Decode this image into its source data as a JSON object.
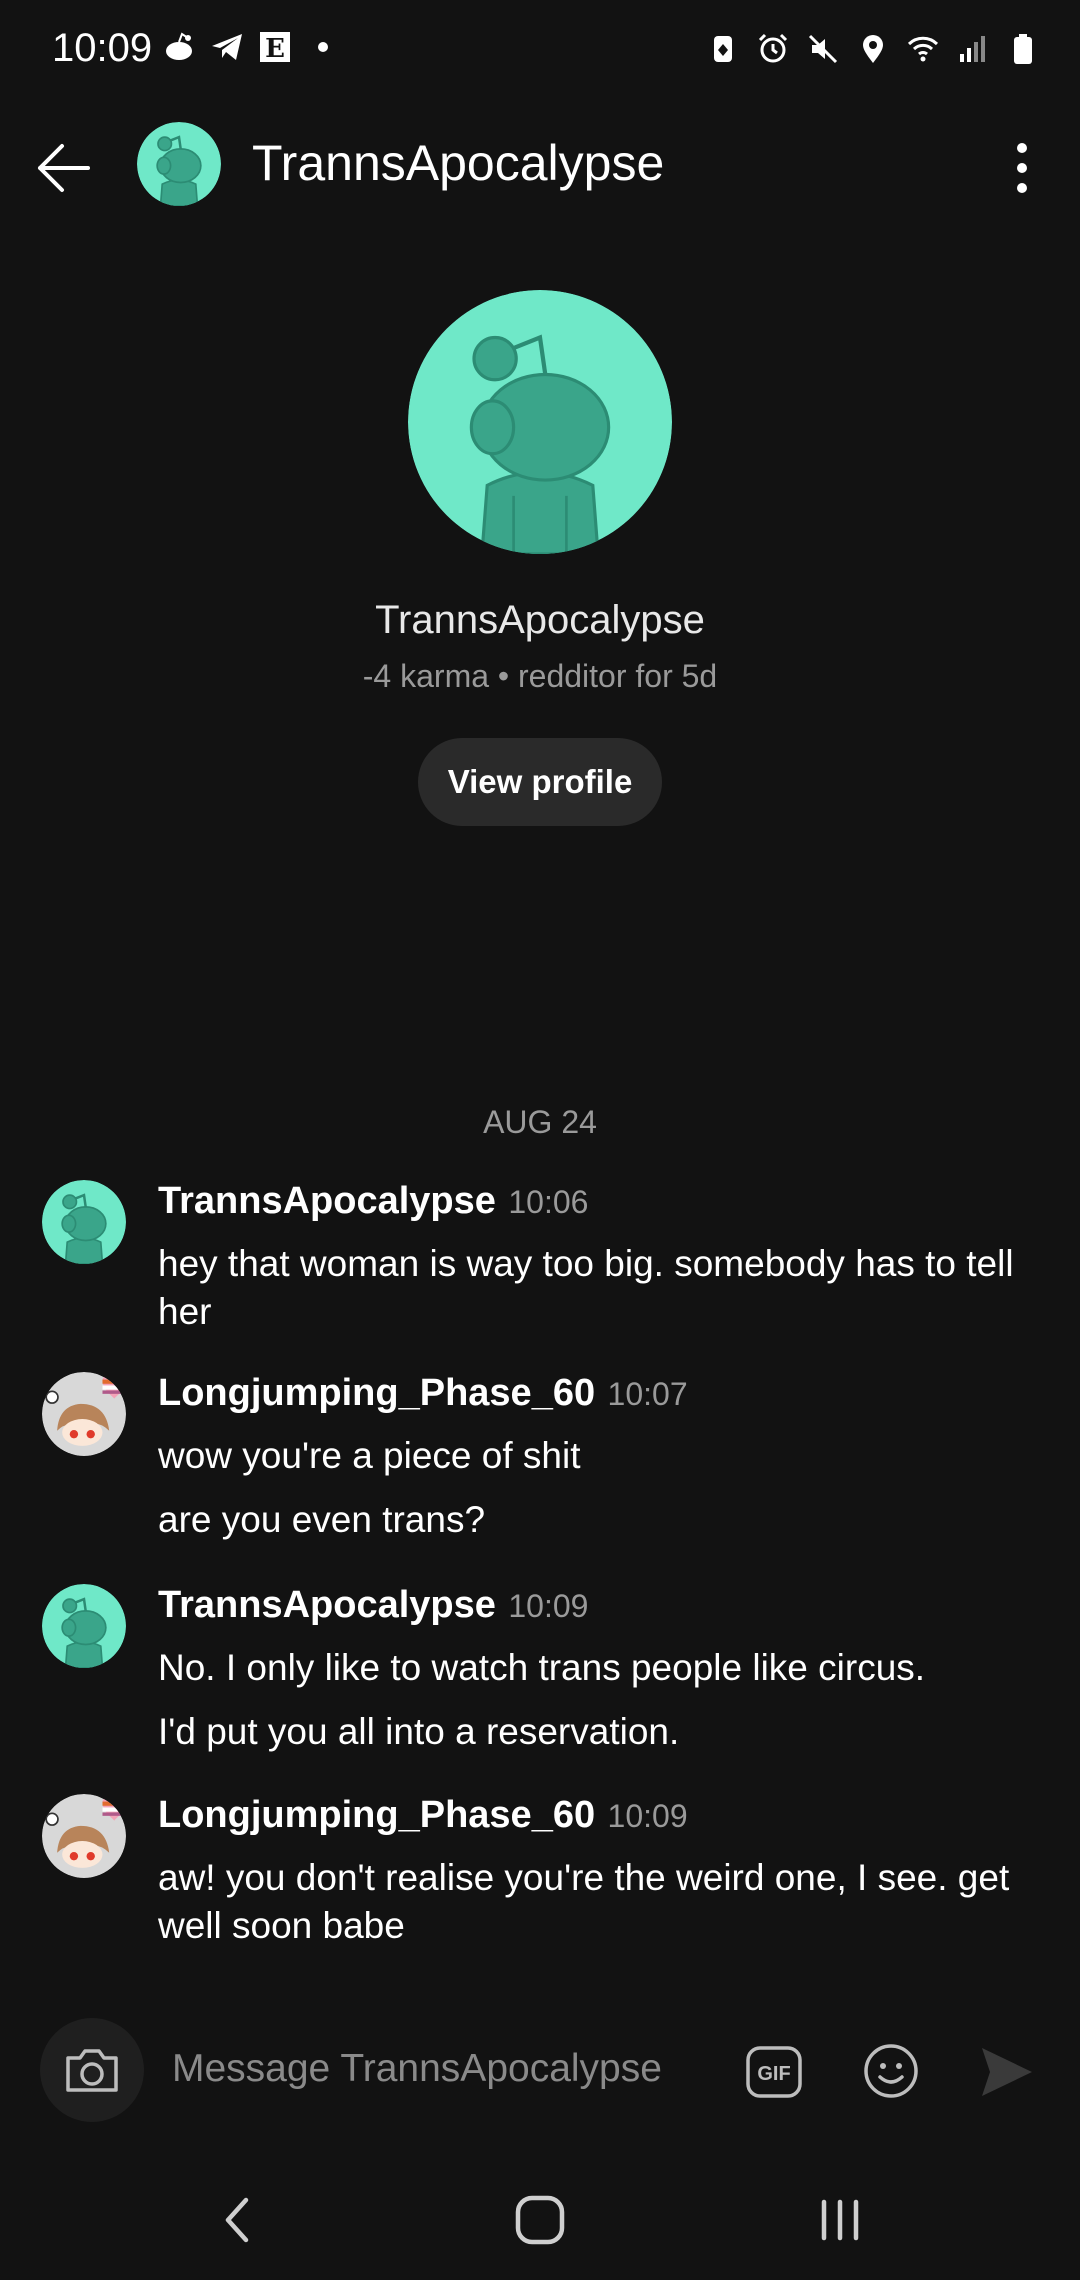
{
  "status_bar": {
    "time": "10:09",
    "left_icons": [
      "snoo-icon",
      "telegram-icon",
      "e-app-icon",
      "dot-icon"
    ],
    "right_icons": [
      "battery-saver-icon",
      "alarm-icon",
      "mute-icon",
      "location-icon",
      "wifi-icon",
      "signal-icon",
      "battery-icon"
    ]
  },
  "header": {
    "title": "TrannsApocalypse"
  },
  "profile": {
    "name": "TrannsApocalypse",
    "meta": "-4 karma • redditor for 5d",
    "view_profile_label": "View profile"
  },
  "conversation": {
    "date_divider": "AUG 24",
    "messages": [
      {
        "user": "TrannsApocalypse",
        "time": "10:06",
        "lines": [
          "hey that woman is way too big. somebody has to tell her"
        ]
      },
      {
        "user": "Longjumping_Phase_60",
        "time": "10:07",
        "lines": [
          "wow you're a piece of shit",
          "are you even trans?"
        ]
      },
      {
        "user": "TrannsApocalypse",
        "time": "10:09",
        "lines": [
          "No. I only like to watch trans people like circus.",
          "I'd put you all into a reservation."
        ]
      },
      {
        "user": "Longjumping_Phase_60",
        "time": "10:09",
        "lines": [
          "aw! you don't realise you're the weird one, I see. get well soon babe"
        ]
      }
    ]
  },
  "composer": {
    "placeholder": "Message TrannsApocalypse",
    "gif_label": "GIF"
  },
  "colors": {
    "background": "#121212",
    "avatar_teal": "#6fe8c8",
    "snoo_teal": "#3aa58a",
    "button_bg": "#2a2a2a",
    "muted_text": "#9a9a9a"
  }
}
